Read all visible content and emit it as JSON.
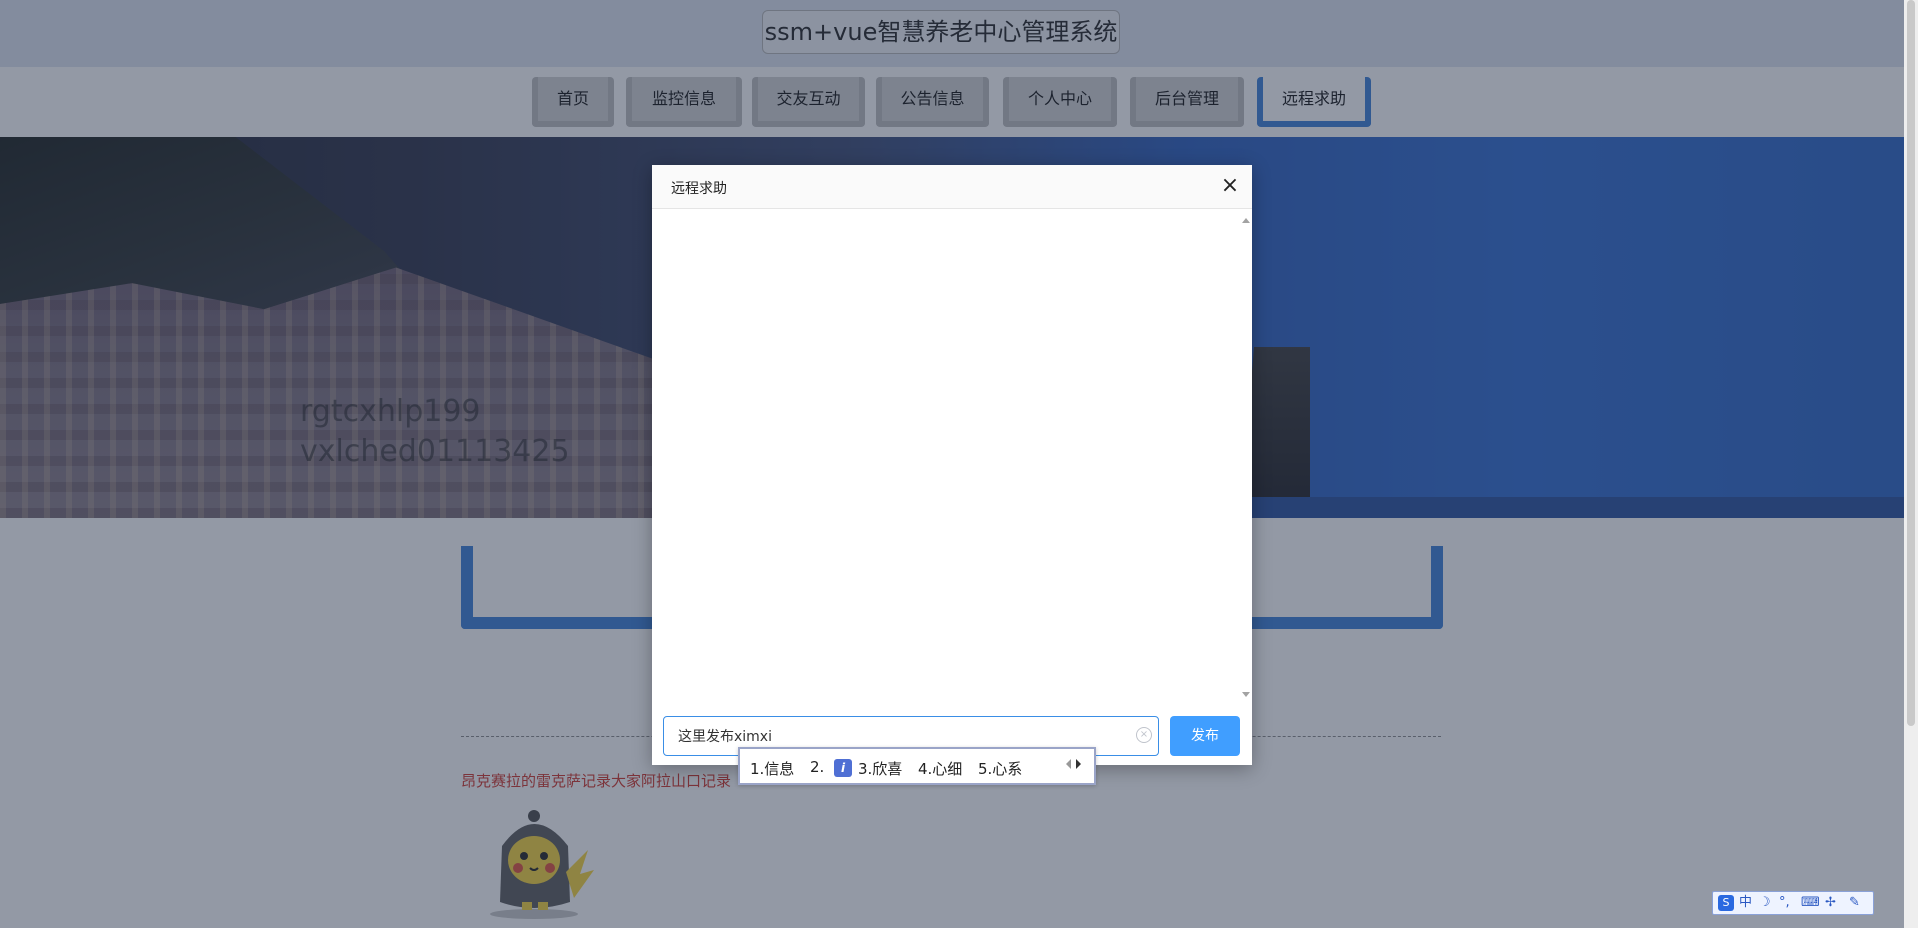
{
  "site": {
    "title": "ssm+vue智慧养老中心管理系统"
  },
  "nav": {
    "items": [
      {
        "label": "首页"
      },
      {
        "label": "监控信息"
      },
      {
        "label": "交友互动"
      },
      {
        "label": "公告信息"
      },
      {
        "label": "个人中心"
      },
      {
        "label": "后台管理"
      },
      {
        "label": "远程求助",
        "active": true
      }
    ]
  },
  "banner": {
    "watermark_line1": "rgtcxhlp199",
    "watermark_line2": "vxlched01113425"
  },
  "page": {
    "red_text": "昂克赛拉的雷克萨记录大家阿拉山口记录"
  },
  "modal": {
    "title": "远程求助",
    "close_glyph": "×",
    "input_value": "这里发布ximxi",
    "publish_label": "发布"
  },
  "ime": {
    "candidates": [
      "1.信息",
      "2.",
      "3.欣喜",
      "4.心细",
      "5.心系"
    ],
    "emoji_glyph": "i"
  },
  "ime_toolbar": {
    "items": [
      "中",
      "☽",
      "°,",
      "⌨",
      "✢",
      "✎"
    ]
  },
  "colors": {
    "accent": "#409eff",
    "nav_active_border": "#3a7fd6",
    "red_text": "#d0352b"
  }
}
